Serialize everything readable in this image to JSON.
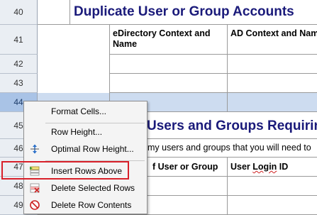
{
  "rows": {
    "r40": "40",
    "r41": "41",
    "r42": "42",
    "r43": "43",
    "r44": "44",
    "r45": "45",
    "r46": "46",
    "r47": "47",
    "r48": "48",
    "r49": "49"
  },
  "sheet": {
    "title1": "Duplicate User or Group Accounts",
    "col_edir": "eDirectory Context and Name",
    "col_ad": "AD Context and Name",
    "title2": "Users and Groups Requiring",
    "desc": "my users and groups that you will need to",
    "col_user_group": "f User or Group",
    "col_login_pre": "User ",
    "col_login_mid": "Login",
    "col_login_post": " ID"
  },
  "menu": {
    "format_cells": "Format Cells...",
    "row_height": "Row Height...",
    "optimal_row_height": "Optimal Row Height...",
    "insert_rows_above": "Insert Rows Above",
    "delete_selected_rows": "Delete Selected Rows",
    "delete_row_contents": "Delete Row Contents"
  },
  "colors": {
    "title": "#1a1a7a",
    "highlight": "#d8202a",
    "selection": "#cddcf0"
  }
}
